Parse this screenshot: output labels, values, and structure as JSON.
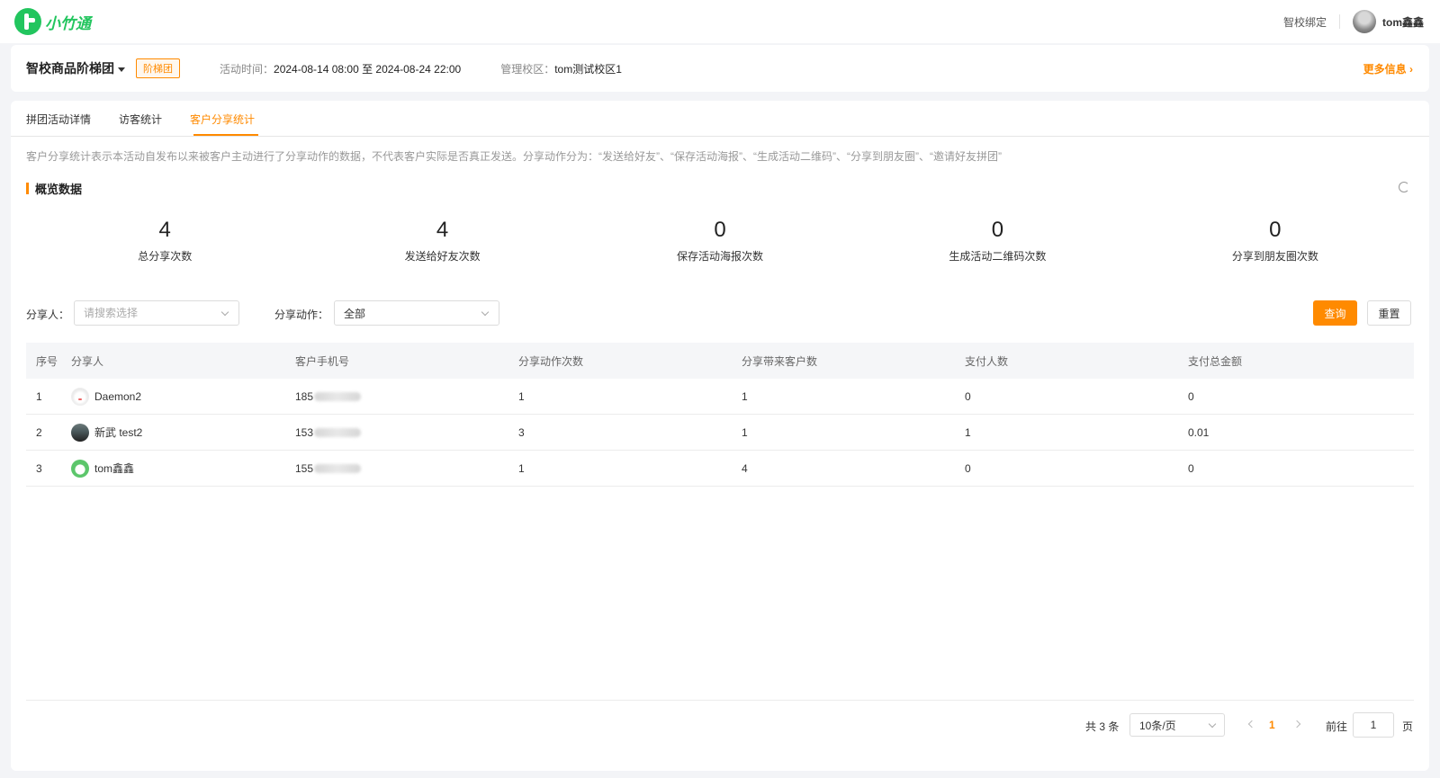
{
  "app": {
    "logo_text": "小竹通"
  },
  "header": {
    "bind_link": "智校绑定",
    "username": "tom鑫鑫"
  },
  "activity": {
    "name": "智校商品阶梯团",
    "tag": "阶梯团",
    "time_label": "活动时间：",
    "time_value": "2024-08-14 08:00 至 2024-08-24 22:00",
    "campus_label": "管理校区：",
    "campus_value": "tom测试校区1",
    "more_info": "更多信息"
  },
  "tabs": [
    {
      "label": "拼团活动详情",
      "active": false
    },
    {
      "label": "访客统计",
      "active": false
    },
    {
      "label": "客户分享统计",
      "active": true
    }
  ],
  "notice": "客户分享统计表示本活动自发布以来被客户主动进行了分享动作的数据，不代表客户实际是否真正发送。分享动作分为：“发送给好友”、“保存活动海报”、“生成活动二维码”、“分享到朋友圈”、“邀请好友拼团”",
  "overview": {
    "title": "概览数据",
    "stats": [
      {
        "value": "4",
        "label": "总分享次数"
      },
      {
        "value": "4",
        "label": "发送给好友次数"
      },
      {
        "value": "0",
        "label": "保存活动海报次数"
      },
      {
        "value": "0",
        "label": "生成活动二维码次数"
      },
      {
        "value": "0",
        "label": "分享到朋友圈次数"
      }
    ]
  },
  "filters": {
    "sharer_label": "分享人：",
    "sharer_placeholder": "请搜索选择",
    "action_label": "分享动作：",
    "action_value": "全部",
    "query_button": "查询",
    "reset_button": "重置"
  },
  "table": {
    "columns": [
      "序号",
      "分享人",
      "客户手机号",
      "分享动作次数",
      "分享带来客户数",
      "支付人数",
      "支付总金额"
    ],
    "rows": [
      {
        "index": "1",
        "sharer": "Daemon2",
        "phone_prefix": "185",
        "actions": "1",
        "customers": "1",
        "payers": "0",
        "amount": "0"
      },
      {
        "index": "2",
        "sharer": "新武 test2",
        "phone_prefix": "153",
        "actions": "3",
        "customers": "1",
        "payers": "1",
        "amount": "0.01"
      },
      {
        "index": "3",
        "sharer": "tom鑫鑫",
        "phone_prefix": "155",
        "actions": "1",
        "customers": "4",
        "payers": "0",
        "amount": "0"
      }
    ]
  },
  "pagination": {
    "total": "共 3 条",
    "page_size": "10条/页",
    "current_page": "1",
    "goto_label": "前往",
    "goto_value": "1",
    "unit": "页"
  },
  "colors": {
    "accent": "#ff8a00",
    "brand": "#22c55e"
  }
}
